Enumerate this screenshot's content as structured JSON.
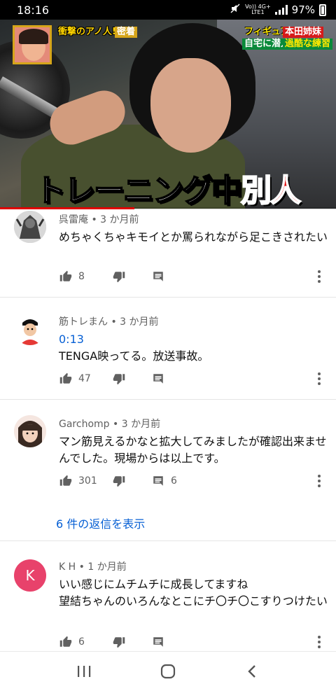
{
  "status_bar": {
    "time": "18:16",
    "network_top": "Vo)) 4G+",
    "network_bottom": "LTE1",
    "battery": "97%"
  },
  "video": {
    "caption_left": "衝撃のアノ人!",
    "caption_left_tag": "密着",
    "caption_right_1": "フィギュア",
    "caption_right_1b": "本田姉妹",
    "caption_right_2": "自宅に潜入",
    "caption_right_2b": "過酷な練習",
    "overlay_title_main": "トレーニング中",
    "overlay_title_accent": "別人",
    "progress_fraction": 0.4
  },
  "comments": [
    {
      "author": "呉雷庵",
      "age": "3 か月前",
      "timestamp_link": "",
      "text": "めちゃくちゃキモイとか罵られながら足こきされたい",
      "likes": "8",
      "reply_count": "",
      "view_replies": ""
    },
    {
      "author": "筋トレまん",
      "age": "3 か月前",
      "timestamp_link": "0:13",
      "text": "TENGA映ってる。放送事故。",
      "likes": "47",
      "reply_count": "",
      "view_replies": ""
    },
    {
      "author": "Garchomp",
      "age": "3 か月前",
      "timestamp_link": "",
      "text": "マン筋見えるかなと拡大してみましたが確認出来ませんでした。現場からは以上です。",
      "likes": "301",
      "reply_count": "6",
      "view_replies": "6 件の返信を表示"
    },
    {
      "author": "K H",
      "age": "1 か月前",
      "avatar_letter": "K",
      "timestamp_link": "",
      "text": "いい感じにムチムチに成長してますね\n望結ちゃんのいろんなとこにチ〇チ〇こすりつけたい",
      "likes": "6",
      "reply_count": "",
      "view_replies": ""
    }
  ],
  "colors": {
    "link_blue": "#065fd4",
    "progress_red": "#e00000",
    "avatar_kh": "#e8426b"
  },
  "icons": {
    "like": "thumb-up-icon",
    "dislike": "thumb-down-icon",
    "reply": "comment-icon",
    "more": "more-vert-icon",
    "nav_recents": "recents-icon",
    "nav_home": "home-icon",
    "nav_back": "back-icon"
  }
}
